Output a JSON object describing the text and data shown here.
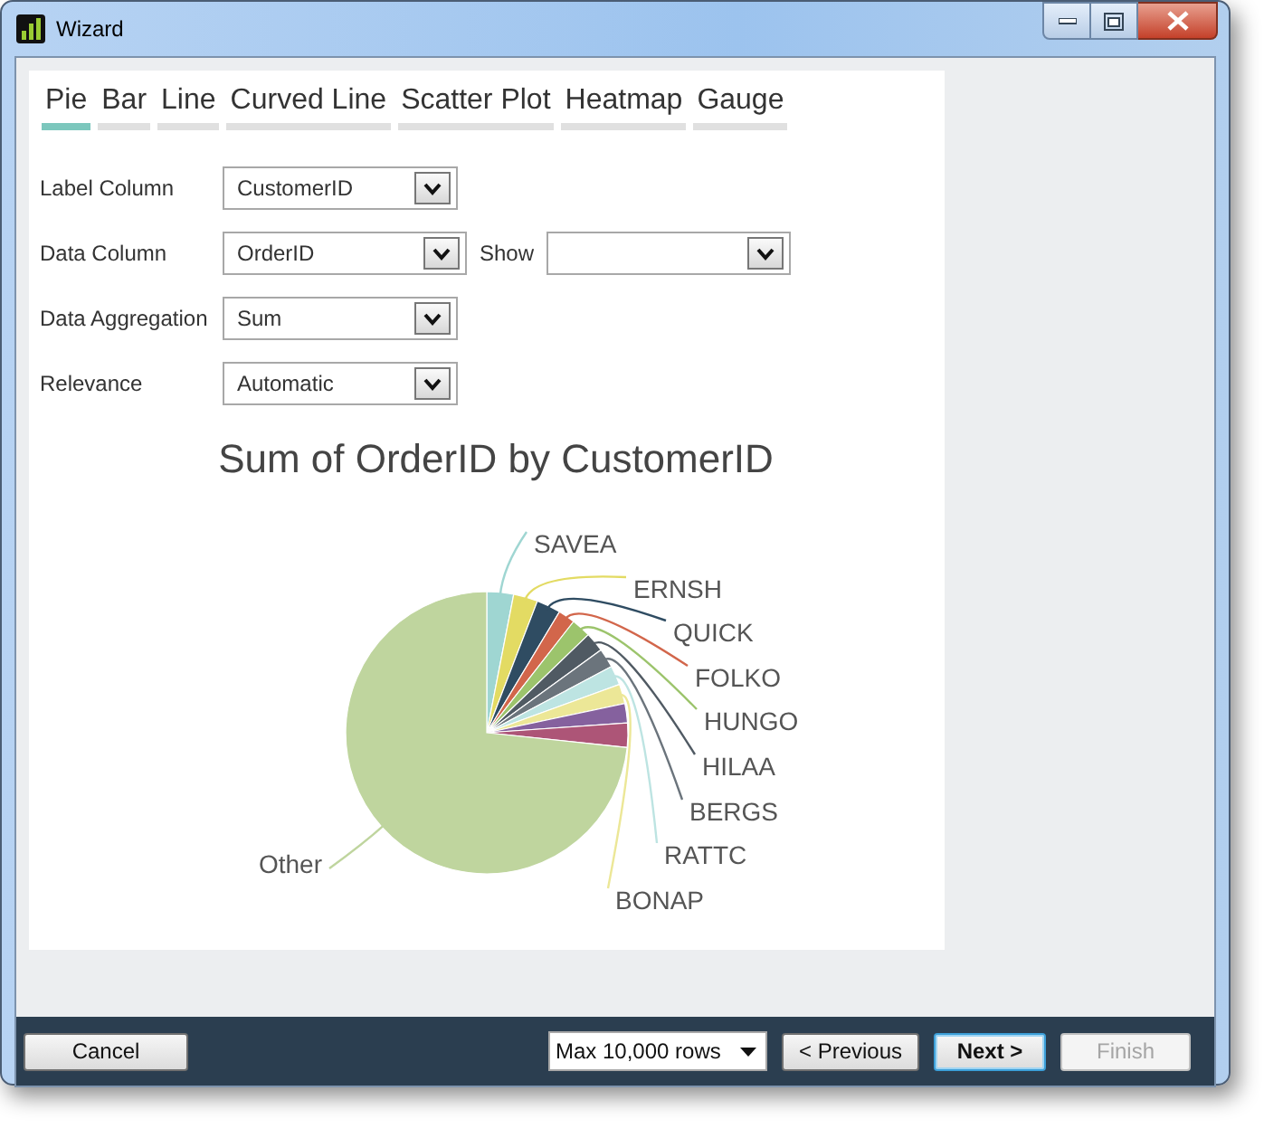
{
  "window": {
    "title": "Wizard"
  },
  "tabs": [
    {
      "label": "Pie",
      "selected": true
    },
    {
      "label": "Bar",
      "selected": false
    },
    {
      "label": "Line",
      "selected": false
    },
    {
      "label": "Curved Line",
      "selected": false
    },
    {
      "label": "Scatter Plot",
      "selected": false
    },
    {
      "label": "Heatmap",
      "selected": false
    },
    {
      "label": "Gauge",
      "selected": false
    }
  ],
  "form": {
    "rows": [
      {
        "fields": [
          {
            "label": "Label Column",
            "value": "CustomerID"
          }
        ]
      },
      {
        "fields": [
          {
            "label": "Data Column",
            "value": "OrderID"
          },
          {
            "label": "Show"
          }
        ]
      },
      {
        "fields": [
          {
            "label": "Data Aggregation",
            "value": "Sum"
          }
        ]
      },
      {
        "fields": [
          {
            "label": "Relevance",
            "value": "Automatic"
          }
        ]
      }
    ]
  },
  "chart": {
    "title": "Sum of OrderID by CustomerID",
    "slice_labels": [
      "SAVEA",
      "ERNSH",
      "QUICK",
      "FOLKO",
      "HUNGO",
      "HILAA",
      "BERGS",
      "RATTC",
      "BONAP",
      "Other"
    ]
  },
  "footer": {
    "left": [
      {
        "kind": "button",
        "label": "Cancel",
        "disabled": false,
        "default": false
      }
    ],
    "right": [
      {
        "kind": "dropdown",
        "label": "Max 10,000 rows"
      },
      {
        "kind": "button",
        "label": "< Previous",
        "disabled": false,
        "default": false
      },
      {
        "kind": "button",
        "label": "Next >",
        "disabled": false,
        "default": true
      },
      {
        "kind": "button",
        "label": "Finish",
        "disabled": true,
        "default": false
      }
    ]
  }
}
